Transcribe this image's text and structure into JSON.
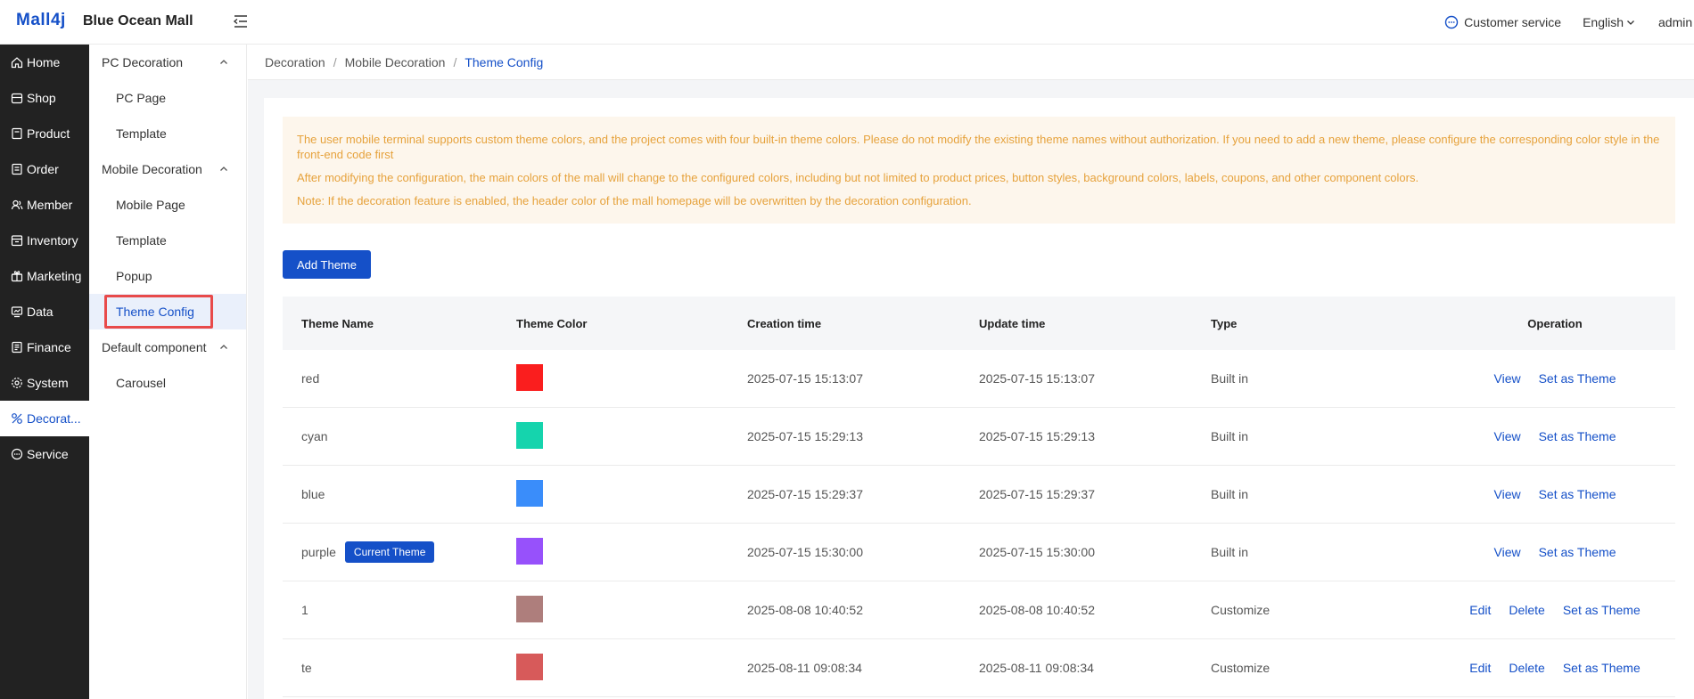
{
  "header": {
    "logo": "Mall4j",
    "mall_name": "Blue Ocean Mall",
    "customer_service": "Customer service",
    "language": "English",
    "user": "admin"
  },
  "sidebar": {
    "items": [
      {
        "label": "Home",
        "icon": "home-icon"
      },
      {
        "label": "Shop",
        "icon": "shop-icon"
      },
      {
        "label": "Product",
        "icon": "product-icon"
      },
      {
        "label": "Order",
        "icon": "order-icon"
      },
      {
        "label": "Member",
        "icon": "member-icon"
      },
      {
        "label": "Inventory",
        "icon": "inventory-icon"
      },
      {
        "label": "Marketing",
        "icon": "marketing-icon"
      },
      {
        "label": "Data",
        "icon": "data-icon"
      },
      {
        "label": "Finance",
        "icon": "finance-icon"
      },
      {
        "label": "System",
        "icon": "system-icon"
      },
      {
        "label": "Decorat...",
        "icon": "decoration-icon"
      },
      {
        "label": "Service",
        "icon": "service-icon"
      }
    ]
  },
  "submenu": {
    "pc_group": "PC Decoration",
    "pc_page": "PC Page",
    "pc_template": "Template",
    "mobile_group": "Mobile Decoration",
    "mobile_page": "Mobile Page",
    "mobile_template": "Template",
    "popup": "Popup",
    "theme_config": "Theme Config",
    "default_group": "Default component",
    "carousel": "Carousel"
  },
  "breadcrumb": {
    "level1": "Decoration",
    "level2": "Mobile Decoration",
    "current": "Theme Config"
  },
  "notice": {
    "line1": "The user mobile terminal supports custom theme colors, and the project comes with four built-in theme colors. Please do not modify the existing theme names without authorization. If you need to add a new theme, please configure the corresponding color style in the front-end code first",
    "line2": "After modifying the configuration, the main colors of the mall will change to the configured colors, including but not limited to product prices, button styles, background colors, labels, coupons, and other component colors.",
    "line3": "Note: If the decoration feature is enabled, the header color of the mall homepage will be overwritten by the decoration configuration."
  },
  "add_theme_label": "Add Theme",
  "table": {
    "headers": {
      "name": "Theme Name",
      "color": "Theme Color",
      "created": "Creation time",
      "updated": "Update time",
      "type": "Type",
      "operation": "Operation"
    },
    "current_tag": "Current Theme",
    "op_view": "View",
    "op_edit": "Edit",
    "op_delete": "Delete",
    "op_set": "Set as Theme",
    "rows": [
      {
        "name": "red",
        "color": "#fa1e1e",
        "created": "2025-07-15 15:13:07",
        "updated": "2025-07-15 15:13:07",
        "type": "Built in",
        "current": false,
        "builtin": true
      },
      {
        "name": "cyan",
        "color": "#15d4ad",
        "created": "2025-07-15 15:29:13",
        "updated": "2025-07-15 15:29:13",
        "type": "Built in",
        "current": false,
        "builtin": true
      },
      {
        "name": "blue",
        "color": "#3a8dfa",
        "created": "2025-07-15 15:29:37",
        "updated": "2025-07-15 15:29:37",
        "type": "Built in",
        "current": false,
        "builtin": true
      },
      {
        "name": "purple",
        "color": "#9751fb",
        "created": "2025-07-15 15:30:00",
        "updated": "2025-07-15 15:30:00",
        "type": "Built in",
        "current": true,
        "builtin": true
      },
      {
        "name": "1",
        "color": "#ae7e7c",
        "created": "2025-08-08 10:40:52",
        "updated": "2025-08-08 10:40:52",
        "type": "Customize",
        "current": false,
        "builtin": false
      },
      {
        "name": "te",
        "color": "#d75a5a",
        "created": "2025-08-11 09:08:34",
        "updated": "2025-08-11 09:08:34",
        "type": "Customize",
        "current": false,
        "builtin": false
      }
    ]
  },
  "colors": {
    "accent": "#1550c8",
    "sidebar_bg": "#222222",
    "notice_text": "#e6a23c",
    "notice_bg": "#fdf6ec",
    "highlight_border": "#e84a4a"
  }
}
